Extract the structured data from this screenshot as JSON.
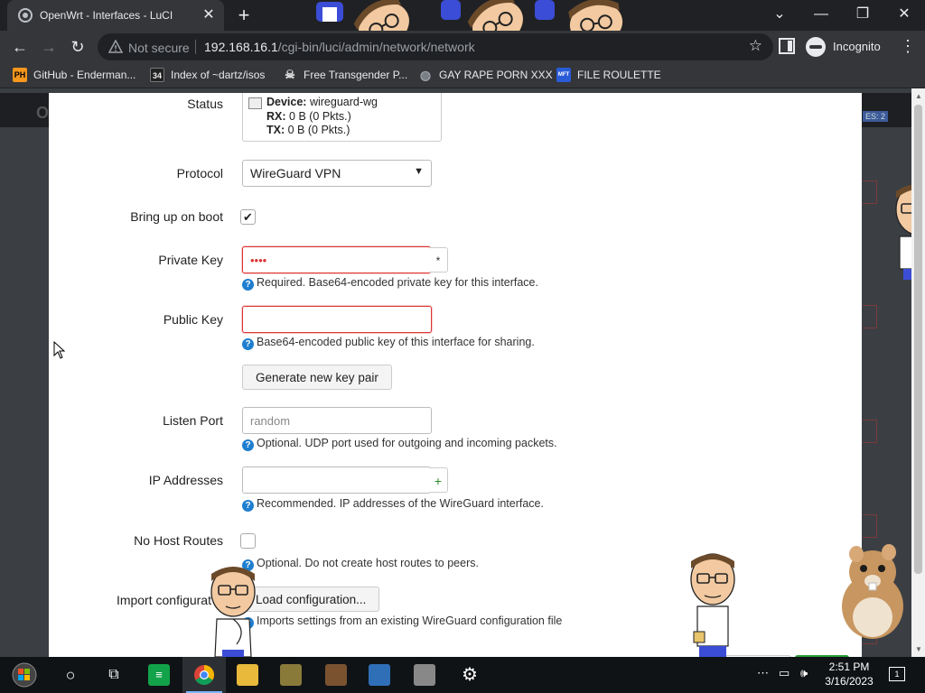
{
  "browser": {
    "tab_title": "OpenWrt - Interfaces - LuCI",
    "not_secure": "Not secure",
    "url_host": "192.168.16.1",
    "url_path": "/cgi-bin/luci/admin/network/network",
    "incognito_label": "Incognito",
    "bookmarks": [
      {
        "label": "GitHub - Enderman...",
        "icon": "PH",
        "icon_color": "#f7971d"
      },
      {
        "label": "Index of ~dartz/isos",
        "icon": "34",
        "icon_color": "#444444"
      },
      {
        "label": "Free Transgender P...",
        "icon": "skull-icon",
        "icon_color": "#dddddd"
      },
      {
        "label": "GAY RAPE PORN XXX",
        "icon": "globe-icon",
        "icon_color": "#9aa0a6"
      },
      {
        "label": "FILE ROULETTE",
        "icon": "MFT",
        "icon_color": "#2a5bd7"
      }
    ]
  },
  "background_page": {
    "logo_letter": "O",
    "badge": "ES: 2"
  },
  "form": {
    "status": {
      "label": "Status",
      "device_label": "Device:",
      "device_value": "wireguard-wg",
      "rx_label": "RX:",
      "rx_value": "0 B (0 Pkts.)",
      "tx_label": "TX:",
      "tx_value": "0 B (0 Pkts.)"
    },
    "protocol": {
      "label": "Protocol",
      "value": "WireGuard VPN"
    },
    "boot": {
      "label": "Bring up on boot",
      "checked": true
    },
    "private_key": {
      "label": "Private Key",
      "value": "••••",
      "reveal": "*",
      "hint": "Required. Base64-encoded private key for this interface."
    },
    "public_key": {
      "label": "Public Key",
      "value": "",
      "hint": "Base64-encoded public key of this interface for sharing."
    },
    "generate_button": "Generate new key pair",
    "listen_port": {
      "label": "Listen Port",
      "placeholder": "random",
      "hint": "Optional. UDP port used for outgoing and incoming packets."
    },
    "ip_addresses": {
      "label": "IP Addresses",
      "add": "+",
      "hint": "Recommended. IP addresses of the WireGuard interface."
    },
    "no_host_routes": {
      "label": "No Host Routes",
      "checked": false,
      "hint": "Optional. Do not create host routes to peers."
    },
    "import_config": {
      "label": "Import configurat",
      "button": "Load configuration...",
      "hint": "Imports settings from an existing WireGuard configuration file"
    }
  },
  "taskbar": {
    "time": "2:51 PM",
    "date": "3/16/2023",
    "notifications": "1"
  },
  "colors": {
    "error_border": "#dd3333",
    "help_icon": "#1f7ecf",
    "chrome_dark": "#202124",
    "chrome_toolbar": "#35363a"
  }
}
